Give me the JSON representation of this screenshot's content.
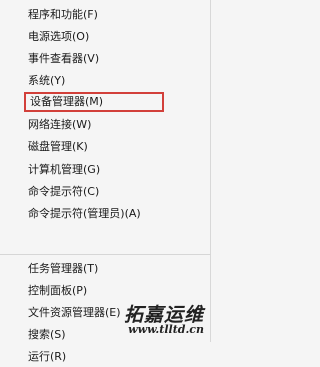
{
  "menu": {
    "group1": [
      {
        "label": "程序和功能(F)"
      },
      {
        "label": "电源选项(O)"
      },
      {
        "label": "事件查看器(V)"
      },
      {
        "label": "系统(Y)"
      },
      {
        "label": "设备管理器(M)",
        "highlighted": true
      },
      {
        "label": "网络连接(W)"
      },
      {
        "label": "磁盘管理(K)"
      },
      {
        "label": "计算机管理(G)"
      },
      {
        "label": "命令提示符(C)"
      },
      {
        "label": "命令提示符(管理员)(A)"
      }
    ],
    "group2": [
      {
        "label": "任务管理器(T)"
      },
      {
        "label": "控制面板(P)"
      },
      {
        "label": "文件资源管理器(E)"
      },
      {
        "label": "搜索(S)"
      },
      {
        "label": "运行(R)"
      }
    ]
  },
  "watermark": {
    "title": "拓嘉运维",
    "url": "www.tlltd.cn"
  },
  "colors": {
    "background": "#f5f5f5",
    "highlight_border": "#d2403a",
    "text": "#1a1a1a"
  }
}
